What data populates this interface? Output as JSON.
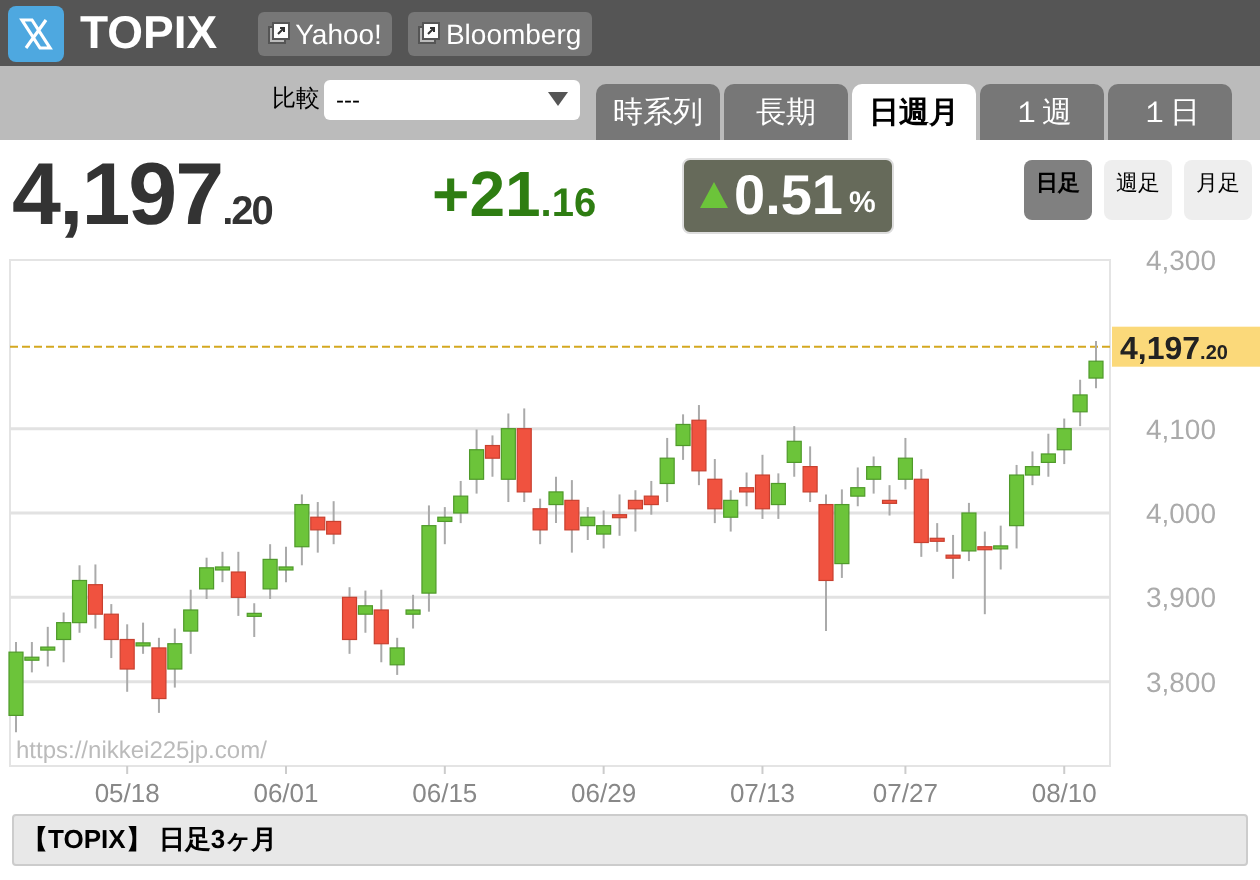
{
  "header": {
    "title": "TOPIX",
    "links": [
      "Yahoo!",
      "Bloomberg"
    ]
  },
  "compare": {
    "label": "比較",
    "value": "---"
  },
  "tabs": [
    {
      "label": "時系列",
      "selected": false
    },
    {
      "label": "長期",
      "selected": false
    },
    {
      "label": "日週月",
      "selected": true
    },
    {
      "label": "１週",
      "selected": false
    },
    {
      "label": "１日",
      "selected": false
    }
  ],
  "quote": {
    "price_main": "4,197",
    "price_decimal": ".20",
    "change_main": "+21",
    "change_decimal": ".16",
    "percent": "0.51",
    "percent_unit": "%",
    "rising": true
  },
  "intervals": [
    {
      "label": "日足",
      "selected": true
    },
    {
      "label": "週足",
      "selected": false
    },
    {
      "label": "月足",
      "selected": false
    }
  ],
  "chart": {
    "current_main": "4,197",
    "current_decimal": ".20",
    "watermark": "https://nikkei225jp.com/",
    "chart_data": {
      "type": "candlestick",
      "categories": [
        null,
        null,
        null,
        null,
        null,
        null,
        null,
        "05/18",
        null,
        null,
        null,
        null,
        null,
        null,
        null,
        null,
        null,
        "06/01",
        null,
        null,
        null,
        null,
        null,
        null,
        null,
        null,
        null,
        "06/15",
        null,
        null,
        null,
        null,
        null,
        null,
        null,
        null,
        null,
        "06/29",
        null,
        null,
        null,
        null,
        null,
        null,
        null,
        null,
        null,
        "07/13",
        null,
        null,
        null,
        null,
        null,
        null,
        null,
        null,
        "07/27",
        null,
        null,
        null,
        null,
        null,
        null,
        null,
        null,
        null,
        "08/10",
        null,
        null
      ],
      "ohlc": [
        [
          3760,
          3847,
          3740,
          3835
        ],
        [
          3828,
          3847,
          3811,
          3829
        ],
        [
          3840,
          3865,
          3818,
          3841
        ],
        [
          3850,
          3882,
          3823,
          3870
        ],
        [
          3870,
          3938,
          3858,
          3920
        ],
        [
          3915,
          3939,
          3863,
          3880
        ],
        [
          3880,
          3892,
          3828,
          3850
        ],
        [
          3850,
          3868,
          3788,
          3815
        ],
        [
          3845,
          3870,
          3833,
          3846
        ],
        [
          3840,
          3852,
          3763,
          3780
        ],
        [
          3815,
          3863,
          3793,
          3845
        ],
        [
          3860,
          3909,
          3833,
          3885
        ],
        [
          3910,
          3947,
          3898,
          3935
        ],
        [
          3935,
          3954,
          3918,
          3936
        ],
        [
          3930,
          3954,
          3878,
          3900
        ],
        [
          3880,
          3893,
          3853,
          3881
        ],
        [
          3910,
          3963,
          3898,
          3945
        ],
        [
          3935,
          3960,
          3918,
          3936
        ],
        [
          3960,
          4022,
          3938,
          4010
        ],
        [
          3995,
          4013,
          3953,
          3980
        ],
        [
          3990,
          4014,
          3963,
          3975
        ],
        [
          3900,
          3912,
          3833,
          3850
        ],
        [
          3880,
          3908,
          3858,
          3890
        ],
        [
          3885,
          3909,
          3823,
          3845
        ],
        [
          3820,
          3852,
          3808,
          3840
        ],
        [
          3880,
          3903,
          3863,
          3885
        ],
        [
          3905,
          4009,
          3883,
          3985
        ],
        [
          3990,
          4007,
          3963,
          3995
        ],
        [
          4000,
          4038,
          3988,
          4020
        ],
        [
          4040,
          4099,
          4023,
          4075
        ],
        [
          4080,
          4092,
          4043,
          4065
        ],
        [
          4040,
          4118,
          4013,
          4100
        ],
        [
          4100,
          4124,
          4013,
          4025
        ],
        [
          4005,
          4017,
          3963,
          3980
        ],
        [
          4010,
          4043,
          3988,
          4025
        ],
        [
          4015,
          4039,
          3953,
          3980
        ],
        [
          3985,
          4007,
          3968,
          3995
        ],
        [
          3975,
          4003,
          3958,
          3985
        ],
        [
          3998,
          4022,
          3973,
          3995
        ],
        [
          4015,
          4027,
          3978,
          4005
        ],
        [
          4020,
          4038,
          3998,
          4010
        ],
        [
          4035,
          4089,
          4013,
          4065
        ],
        [
          4080,
          4117,
          4063,
          4105
        ],
        [
          4110,
          4128,
          4033,
          4050
        ],
        [
          4040,
          4064,
          3988,
          4005
        ],
        [
          3995,
          4027,
          3978,
          4015
        ],
        [
          4030,
          4048,
          4008,
          4025
        ],
        [
          4045,
          4069,
          3993,
          4005
        ],
        [
          4010,
          4047,
          3993,
          4035
        ],
        [
          4060,
          4103,
          4043,
          4085
        ],
        [
          4055,
          4079,
          4013,
          4025
        ],
        [
          4010,
          4022,
          3860,
          3920
        ],
        [
          3940,
          4028,
          3923,
          4010
        ],
        [
          4020,
          4054,
          4008,
          4030
        ],
        [
          4040,
          4067,
          4023,
          4055
        ],
        [
          4015,
          4033,
          3997,
          4014
        ],
        [
          4040,
          4089,
          4028,
          4065
        ],
        [
          4040,
          4052,
          3948,
          3965
        ],
        [
          3970,
          3988,
          3954,
          3969
        ],
        [
          3950,
          3974,
          3922,
          3949
        ],
        [
          3955,
          4012,
          3943,
          4000
        ],
        [
          3960,
          3978,
          3880,
          3959
        ],
        [
          3960,
          3985,
          3933,
          3961
        ],
        [
          3985,
          4057,
          3958,
          4045
        ],
        [
          4045,
          4073,
          4033,
          4055
        ],
        [
          4060,
          4094,
          4043,
          4070
        ],
        [
          4075,
          4112,
          4058,
          4100
        ],
        [
          4120,
          4158,
          4103,
          4140
        ],
        [
          4160,
          4204,
          4148,
          4180
        ]
      ],
      "ylim": [
        3700,
        4300
      ],
      "yticks": [
        {
          "value": 4300,
          "label": "4,300"
        },
        {
          "value": 4100,
          "label": "4,100"
        },
        {
          "value": 4000,
          "label": "4,000"
        },
        {
          "value": 3900,
          "label": "3,900"
        },
        {
          "value": 3800,
          "label": "3,800"
        }
      ],
      "grid": true,
      "ref_lines": [
        {
          "axis": "y",
          "value": 4197.2
        }
      ]
    }
  },
  "footer": "【TOPIX】 日足3ヶ月"
}
